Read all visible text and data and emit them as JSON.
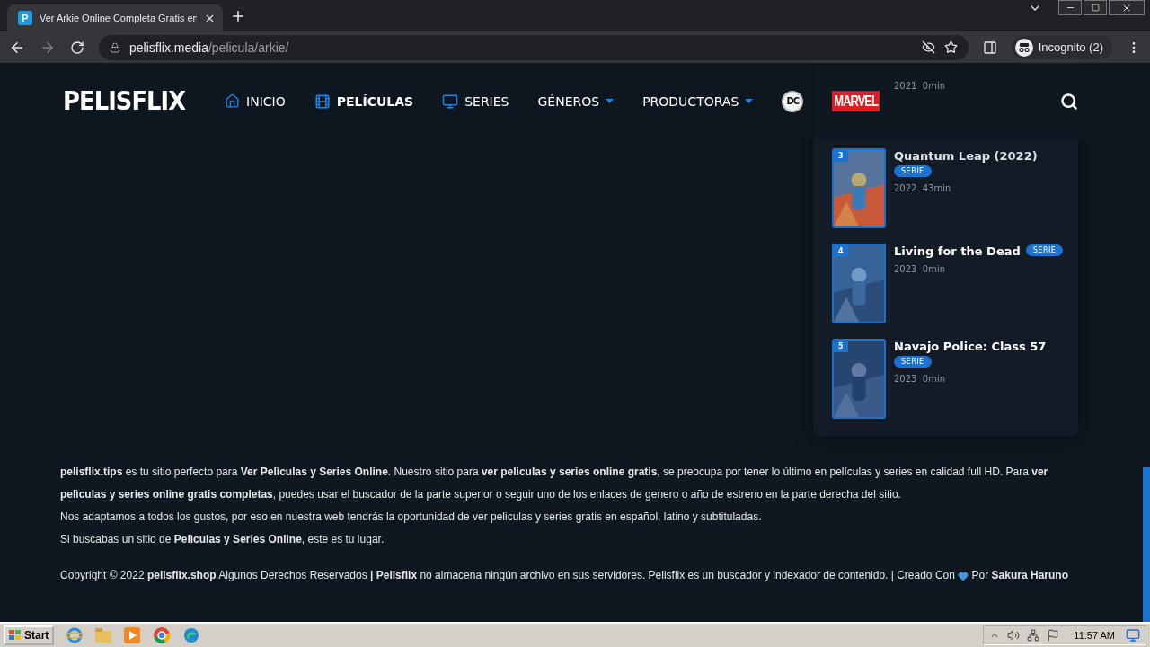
{
  "browser": {
    "tab_title": "Ver Arkie Online Completa Gratis en",
    "favicon": "P",
    "url_host": "pelisflix.media",
    "url_path": "/pelicula/arkie/",
    "profile": "Incognito (2)"
  },
  "header": {
    "logo": "PELISFLIX",
    "nav": [
      {
        "kind": "link",
        "label": "INICIO",
        "selected": false
      },
      {
        "kind": "link",
        "label": "PELÍCULAS",
        "selected": true
      },
      {
        "kind": "link",
        "label": "SERIES",
        "selected": false
      },
      {
        "kind": "menu",
        "label": "GÉNEROS",
        "selected": false
      },
      {
        "kind": "menu",
        "label": "PRODUCTORAS",
        "selected": false
      },
      {
        "kind": "circle",
        "label": "DC",
        "selected": false
      },
      {
        "kind": "logo",
        "label": "MARVEL",
        "selected": false
      }
    ]
  },
  "ranking": [
    {
      "meta": "2021  0min"
    },
    {
      "rank": "3",
      "title": "Quantum Leap (2022)",
      "badge": "SERIE",
      "badge_inline": false,
      "meta": "2022  43min"
    },
    {
      "rank": "4",
      "title": "Living for the Dead",
      "badge": "SERIE",
      "badge_inline": true,
      "meta": "2023  0min"
    },
    {
      "rank": "5",
      "title": "Navajo Police: Class 57",
      "badge": "SERIE",
      "badge_inline": false,
      "meta": "2023  0min"
    }
  ],
  "footer": {
    "paragraphs": [
      "**pelisflix.tips** es tu sitio perfecto para **Ver Pelìculas y Series Online**. Nuestro sitio para **ver peliculas y series online gratis**, se preocupa por tener lo último en películas y series en calidad full HD. Para **ver pelìculas y series online gratis completas**, puedes usar el buscador de la parte superior o seguir uno de los enlaces de genero o año de estreno en la parte derecha del sitio.",
      "Nos adaptamos a todos los gustos, por eso en nuestra web tendrás la oportunidad de ver peliculas y series gratis en español, latino y subtituladas.",
      "Si buscabas un sitio de **Pelìculas y Series Online**, este es tu lugar."
    ],
    "copyright": "Copyright © 2022 **pelisflix.shop** Algunos Derechos Reservados **| Pelisflix** no almacena ningún archivo en sus servidores. Pelisflix es un buscador y indexador de contenido. | Creado Con",
    "credit": "Por **Sakura Haruno**"
  },
  "taskbar": {
    "start": "Start",
    "time": "11:57 AM"
  }
}
